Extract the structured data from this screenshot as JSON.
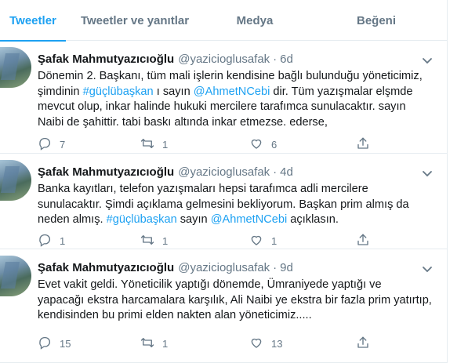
{
  "tabs": [
    {
      "label": "Tweetler",
      "active": true
    },
    {
      "label": "Tweetler ve yanıtlar",
      "active": false
    },
    {
      "label": "Medya",
      "active": false
    },
    {
      "label": "Beğeni",
      "active": false
    }
  ],
  "tweets": [
    {
      "name": "Şafak Mahmutyazıcıoğlu",
      "handle": "@yazicioglusafak",
      "separator": "·",
      "time": "6d",
      "lines": [
        {
          "a": "Dönemin 2. Başkanı, tüm mali işlerin kendisine bağlı bulunduğu yöneticimiz,"
        },
        {
          "a": "şimdinin ",
          "link1": "#güçlübaşkan",
          "b": " ı sayın ",
          "link2": "@AhmetNCebi",
          "c": "  dir. Tüm yazışmalar elşmde"
        },
        {
          "a": "mevcut olup, inkar halinde hukuki mercilere tarafımca sunulacaktır. sayın"
        },
        {
          "a": "Naibi de şahittir. tabi baskı altında inkar etmezse. ederse,"
        }
      ],
      "replies": "7",
      "retweets": "1",
      "likes": "6"
    },
    {
      "name": "Şafak Mahmutyazıcıoğlu",
      "handle": "@yazicioglusafak",
      "separator": "·",
      "time": "4d",
      "lines": [
        {
          "a": "Banka kayıtları, telefon yazışmaları hepsi tarafımca adli mercilere"
        },
        {
          "a": "sunulacaktır. Şimdi açıklama gelmesini bekliyorum. Başkan prim almış da"
        },
        {
          "a": "neden almış. ",
          "link1": "#güçlübaşkan",
          "b": " sayın ",
          "link2": "@AhmetNCebi",
          "c": "  açıklasın."
        }
      ],
      "replies": "1",
      "retweets": "1",
      "likes": "1"
    },
    {
      "name": "Şafak Mahmutyazıcıoğlu",
      "handle": "@yazicioglusafak",
      "separator": "·",
      "time": "9d",
      "lines": [
        {
          "a": "Evet vakit geldi. Yöneticilik yaptığı dönemde, Ümraniyede yaptığı ve"
        },
        {
          "a": "yapacağı ekstra harcamalara karşılık, Ali Naibi ye ekstra bir fazla prim yatırtıp,"
        },
        {
          "a": "kendisinden bu primi elden nakten alan yöneticimiz....."
        }
      ],
      "replies": "15",
      "retweets": "1",
      "likes": "13"
    }
  ],
  "colors": {
    "accent": "#1da1f2",
    "text": "#14171a",
    "muted": "#657786",
    "border": "#e6ecf0"
  },
  "icons": [
    "reply-icon",
    "retweet-icon",
    "like-icon",
    "share-icon",
    "chevron-down-icon"
  ]
}
